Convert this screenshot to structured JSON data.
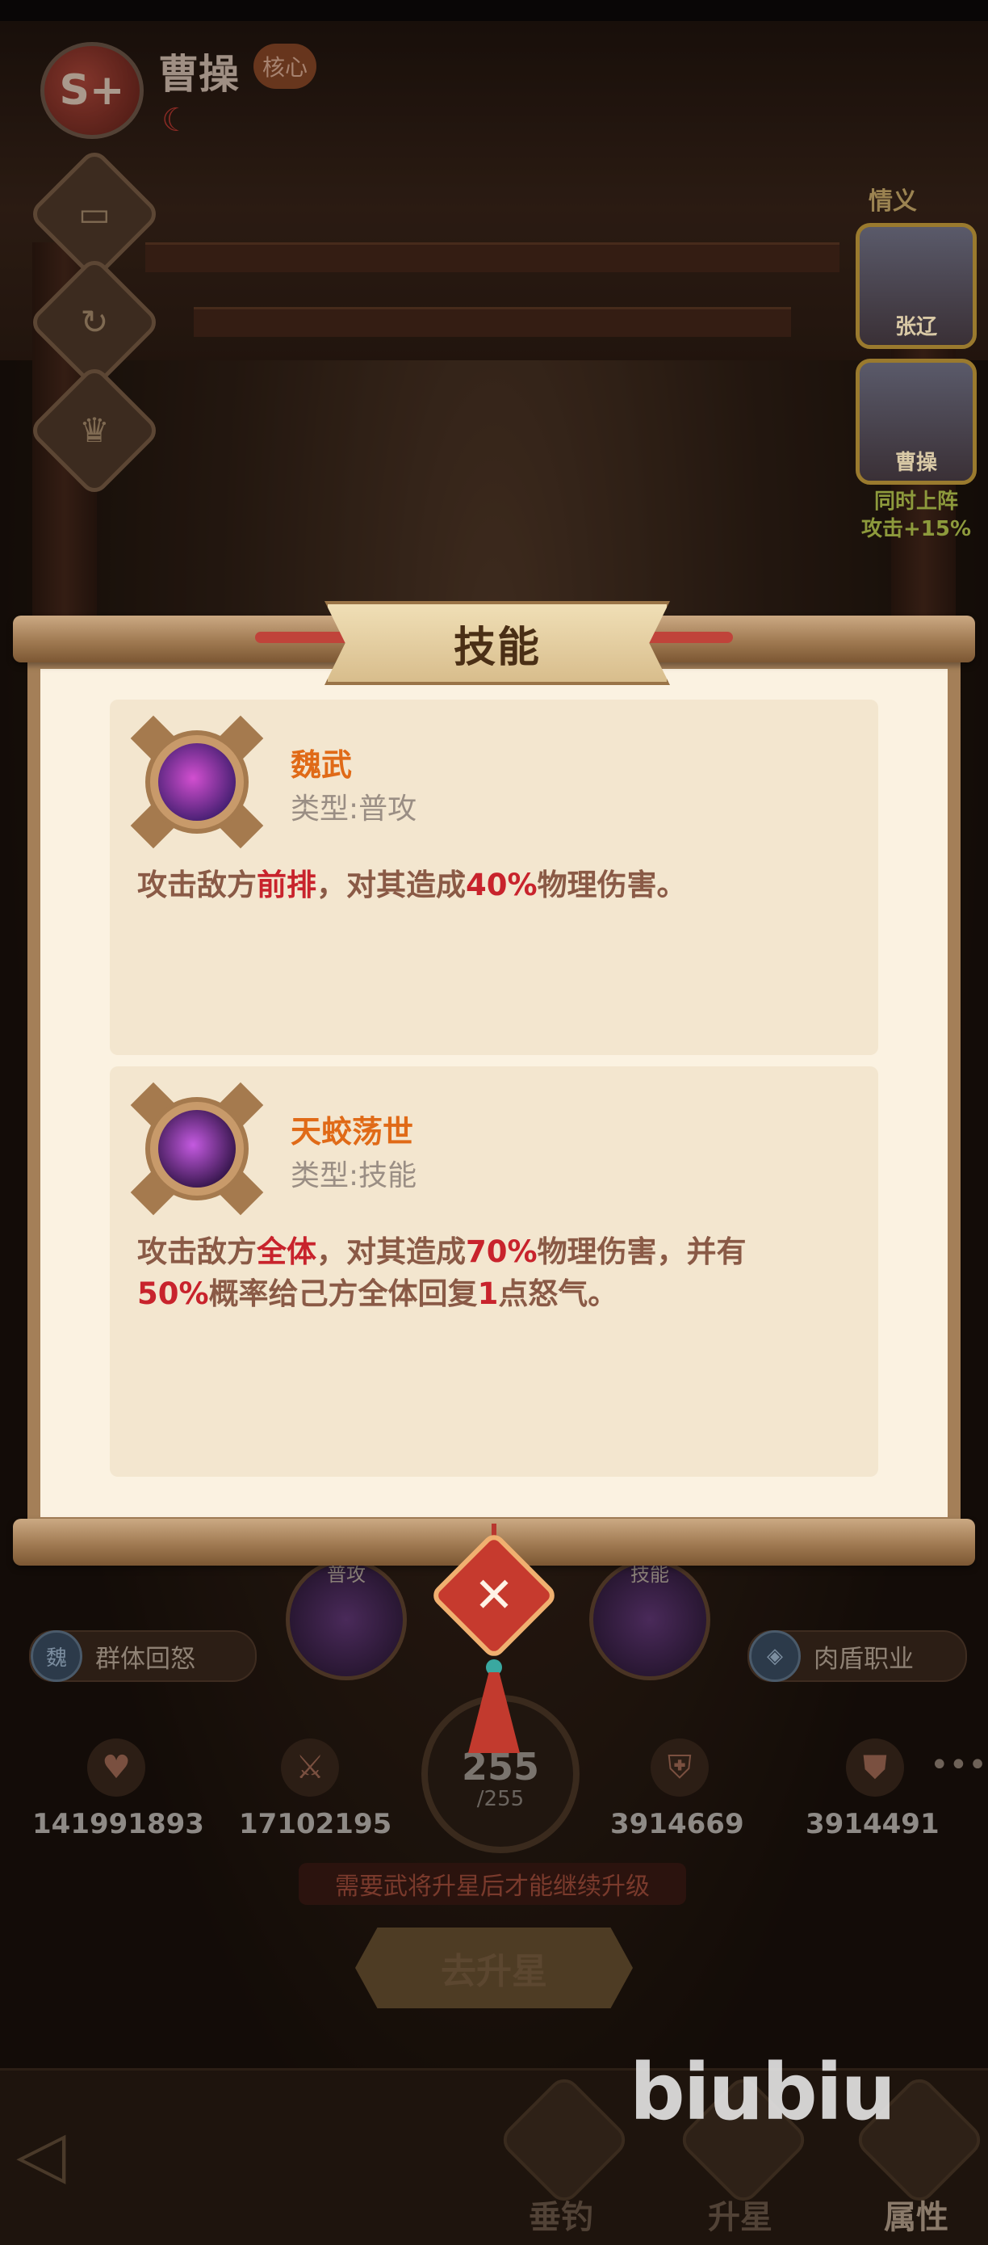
{
  "hero": {
    "rank": "S+",
    "name": "曹操",
    "core_tag": "核心"
  },
  "bond": {
    "label": "情义",
    "partners": [
      {
        "name": "张辽"
      },
      {
        "name": "曹操"
      }
    ],
    "note_line1": "同时上阵",
    "note_line2": "攻击+15%"
  },
  "dialog": {
    "title": "技能",
    "skills": [
      {
        "name": "魏武",
        "type": "类型:普攻",
        "desc": {
          "p1": "攻击敌方",
          "h1": "前排",
          "p2": "，对其造成",
          "h2": "40%",
          "p3": "物理伤害。"
        },
        "colors": [
          "#d24fd0",
          "#3a1b6a"
        ]
      },
      {
        "name": "天蛟荡世",
        "type": "类型:技能",
        "desc": {
          "p1": "攻击敌方",
          "h1": "全体",
          "p2": "，对其造成",
          "h2": "70%",
          "p3": "物理伤害，并有",
          "h3": "50%",
          "p4": "概率给己方全体回复",
          "h4": "1",
          "p5": "点怒气。"
        },
        "colors": [
          "#c45ae0",
          "#2a1040"
        ]
      }
    ],
    "close_symbol": "✕"
  },
  "bottom": {
    "skill_labels": {
      "normal": "普攻",
      "skill": "技能"
    },
    "traits": {
      "left": "群体回怒",
      "left_icon": "魏",
      "right": "肉盾职业"
    },
    "stats": {
      "hp": "141991893",
      "attack": "17102195",
      "defense": "3914669",
      "magic_defense": "3914491"
    },
    "level": {
      "current": "255",
      "max": "/255"
    },
    "warning": "需要武将升星后才能继续升级",
    "star_button": "去升星",
    "nav": {
      "fishing": "垂钓",
      "star": "升星",
      "attr": "属性"
    }
  },
  "watermark": "biubiu",
  "colors": {
    "accent_orange": "#e06a17",
    "highlight_red": "#c8232c",
    "paper": "#fbf2e1"
  }
}
